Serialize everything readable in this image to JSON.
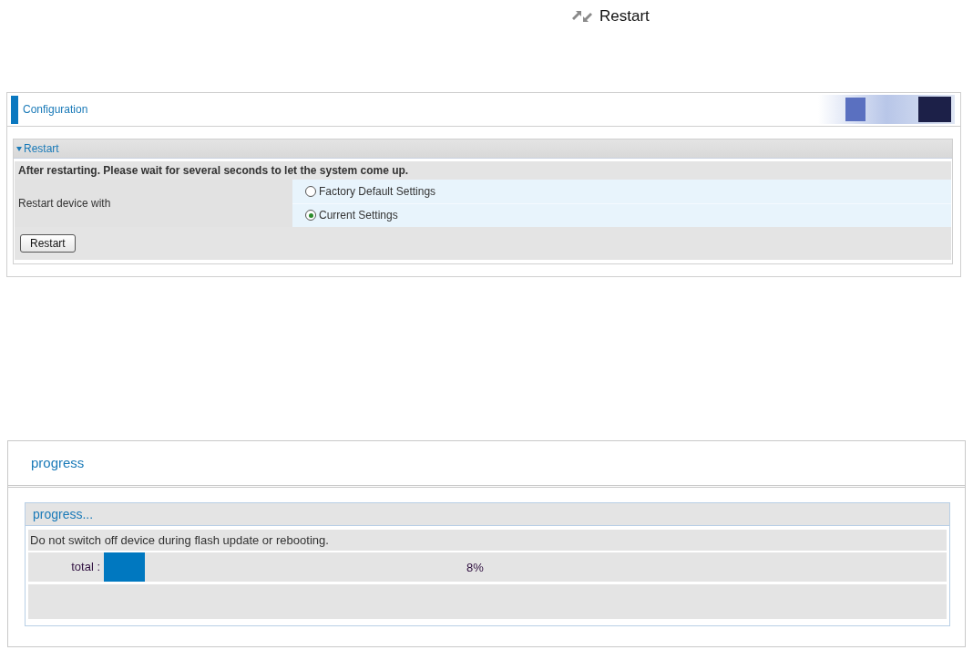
{
  "page_title": "Restart",
  "config_panel": {
    "title": "Configuration",
    "section": {
      "title": "Restart",
      "expanded": true,
      "note": "After restarting. Please wait for several seconds to let the system come up.",
      "field_label": "Restart device with",
      "options": [
        {
          "label": "Factory Default Settings",
          "selected": false
        },
        {
          "label": "Current Settings",
          "selected": true
        }
      ],
      "button": "Restart"
    }
  },
  "progress_panel": {
    "title": "progress",
    "section": {
      "title": "progress...",
      "note": "Do not switch off device during flash update or rebooting.",
      "label": "total :",
      "level": 0.08,
      "reading": "8%"
    }
  }
}
